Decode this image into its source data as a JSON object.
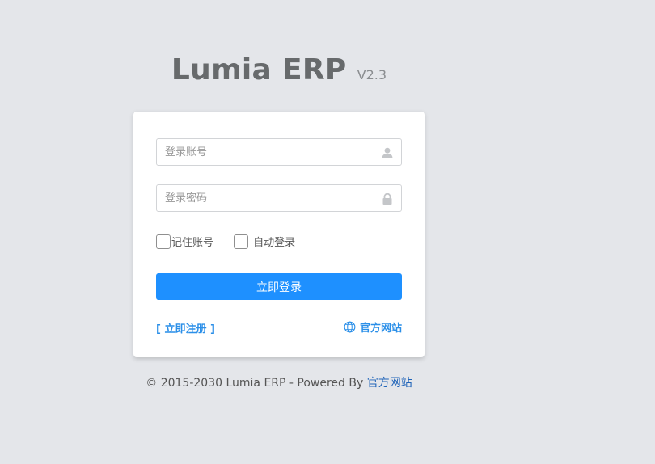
{
  "app": {
    "name": "Lumia ERP",
    "version": "V2.3"
  },
  "login": {
    "username_placeholder": "登录账号",
    "password_placeholder": "登录密码",
    "remember_label": "记住账号",
    "autologin_label": "自动登录",
    "submit_label": "立即登录",
    "register_link": "[ 立即注册 ]",
    "official_site_link": "官方网站"
  },
  "footer": {
    "copyright": "© 2015-2030 Lumia ERP - Powered By ",
    "link": "官方网站"
  },
  "icons": {
    "username": "user-icon",
    "password": "lock-icon",
    "site": "globe-icon"
  },
  "colors": {
    "background": "#e4e6ea",
    "primary": "#1e90ff",
    "link": "#2b8fe8",
    "title": "#676a6c"
  }
}
